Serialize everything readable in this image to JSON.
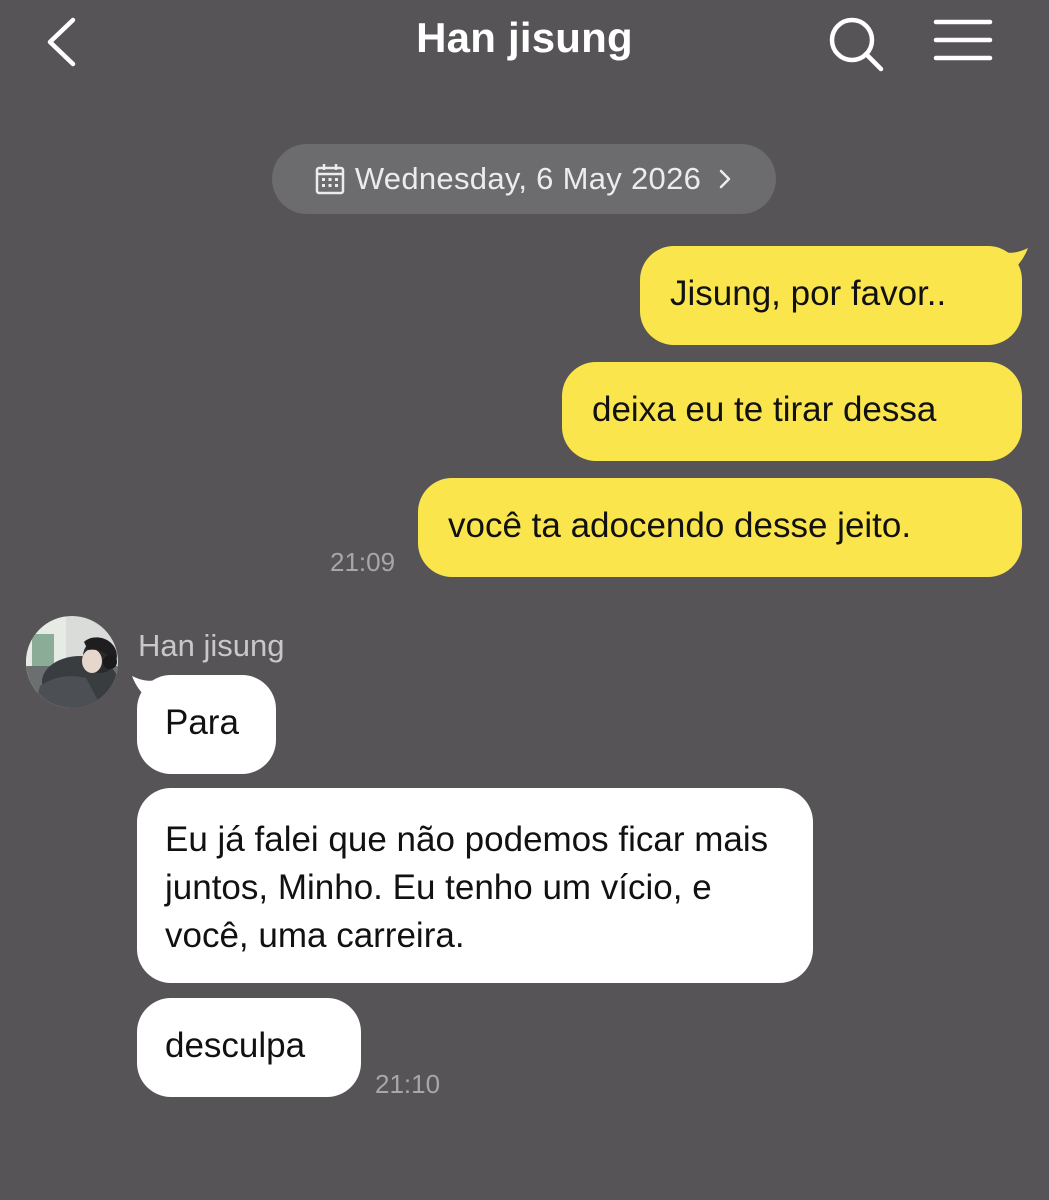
{
  "header": {
    "title": "Han jisung",
    "back_icon": "chevron-left-icon",
    "search_icon": "search-icon",
    "menu_icon": "hamburger-menu-icon"
  },
  "date_divider": {
    "label": "Wednesday, 6 May 2026",
    "icon": "calendar-icon"
  },
  "colors": {
    "background": "#565456",
    "outgoing_bubble": "#fae54d",
    "incoming_bubble": "#ffffff",
    "date_pill": "#6c6b6d"
  },
  "messages": {
    "outgoing": [
      {
        "text": "Jisung, por favor.."
      },
      {
        "text": "deixa eu te tirar dessa"
      },
      {
        "text": "você ta adocendo desse jeito."
      }
    ],
    "outgoing_time": "21:09",
    "sender_name": "Han jisung",
    "incoming": [
      {
        "text": "Para"
      },
      {
        "text": "Eu já falei que não podemos ficar mais juntos, Minho. Eu tenho um vício, e você, uma carreira."
      },
      {
        "text": "desculpa"
      }
    ],
    "incoming_time": "21:10"
  }
}
